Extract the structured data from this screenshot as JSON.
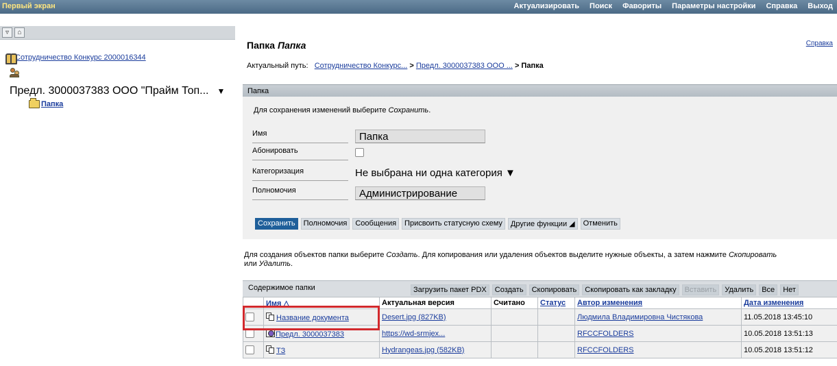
{
  "topbar": {
    "app_title": "Первый экран",
    "menu": [
      "Актуализировать",
      "Поиск",
      "Фавориты",
      "Параметры настройки",
      "Справка",
      "Выход"
    ]
  },
  "left": {
    "toolbar_icons": [
      "collapse-icon",
      "home-icon"
    ],
    "tree_root": "Сотрудничество Конкурс 2000016344",
    "selection": "Предл. 3000037383 ООО \"Прайм Топ...",
    "folder": "Папка"
  },
  "main": {
    "title_prefix": "Папка",
    "title_name": "Папка",
    "help": "Справка",
    "path_label": "Актуальный путь:",
    "path_1": "Сотрудничество Конкурс...",
    "path_sep": ">",
    "path_2": "Предл. 3000037383 ООО ...",
    "path_current": "> Папка"
  },
  "panel": {
    "header": "Папка",
    "hint_prefix": "Для сохранения изменений выберите ",
    "hint_action": "Сохранить",
    "hint_suffix": ".",
    "fields": {
      "name_label": "Имя",
      "name_value": "Папка",
      "subscribe_label": "Абонировать",
      "category_label": "Категоризация",
      "category_value": "Не выбрана ни одна категория ▼",
      "rights_label": "Полномочия",
      "rights_value": "Администрирование"
    },
    "actions": [
      "Сохранить",
      "Полномочия",
      "Сообщения",
      "Присвоить статусную схему",
      "Другие функции ◢",
      "Отменить"
    ]
  },
  "info": {
    "p1": "Для создания объектов папки выберите ",
    "a1": "Создать",
    "p2": ". Для копирования или удаления объектов выделите нужные объекты, а затем нажмите ",
    "a2": "Скопировать",
    "p3": " или ",
    "a3": "Удалить",
    "p4": "."
  },
  "content": {
    "title": "Содержимое папки",
    "buttons": [
      "Загрузить пакет PDX",
      "Создать",
      "Скопировать",
      "Скопировать как закладку",
      "Вставить",
      "Удалить",
      "Все",
      "Нет"
    ],
    "columns": [
      "Имя △",
      "Актуальная версия",
      "Считано",
      "Статус",
      "Автор изменения",
      "Дата изменения"
    ],
    "rows": [
      {
        "icon": "document-icon",
        "name": "Название документа",
        "version": "Desert.jpg (827KB)",
        "read": "",
        "status": "",
        "author": "Людмила Владимировна Чистякова",
        "date": "11.05.2018 13:45:10"
      },
      {
        "icon": "proposal-icon",
        "name": "Предл. 3000037383",
        "version": "https://wd-srmjex...",
        "read": "",
        "status": "",
        "author": "RFCCFOLDERS",
        "date": "10.05.2018 13:51:13"
      },
      {
        "icon": "document-icon",
        "name": "ТЗ",
        "version": "Hydrangeas.jpg (582KB)",
        "read": "",
        "status": "",
        "author": "RFCCFOLDERS",
        "date": "10.05.2018 13:51:12"
      }
    ]
  },
  "colors": {
    "topbar": "#5a7893",
    "primary_button": "#1f5f9a",
    "highlight": "#d2292d",
    "link": "#1a3c9c"
  }
}
